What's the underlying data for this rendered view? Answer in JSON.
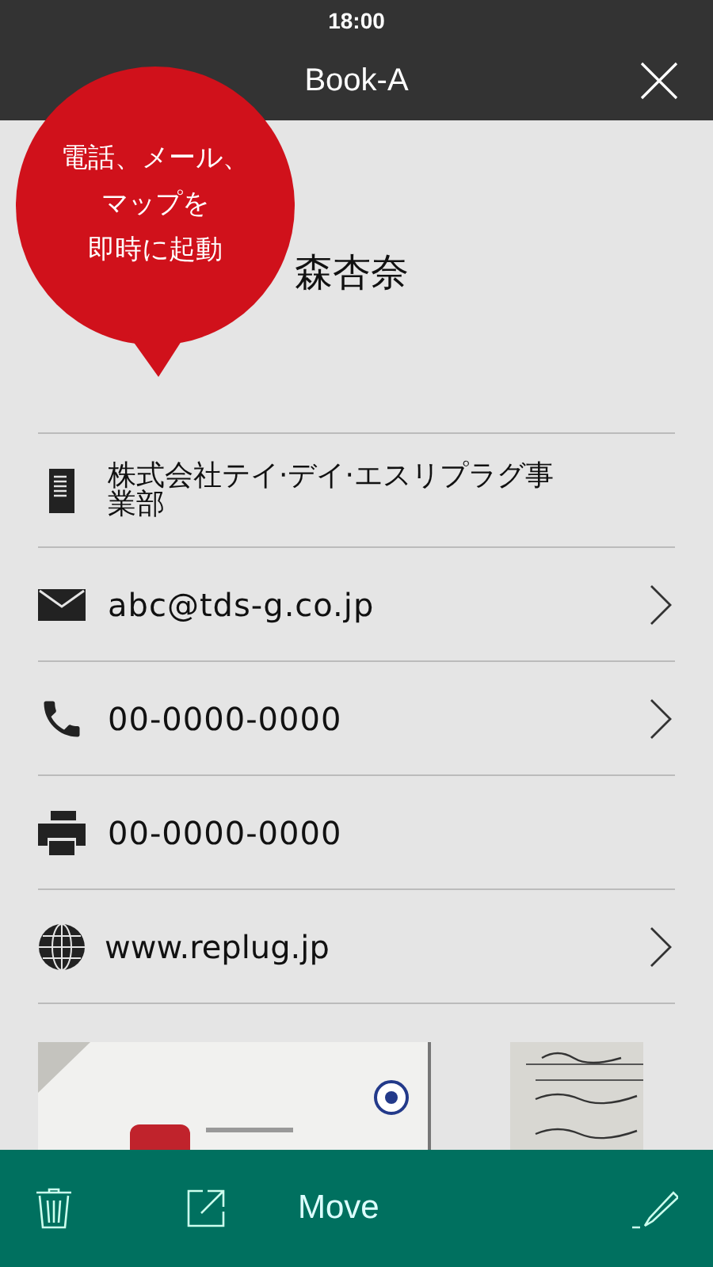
{
  "status_bar": {
    "time": "18:00"
  },
  "header": {
    "title": "Book-A"
  },
  "callout": {
    "lines": [
      "電話、メール、",
      "マップを",
      "即時に起動"
    ]
  },
  "contact": {
    "name": "森杏奈"
  },
  "rows": [
    {
      "kind": "company",
      "text": "株式会社テイ·デイ·エスリプラグ事業部",
      "has_arrow": false
    },
    {
      "kind": "email",
      "text": "abc@tds-g.co.jp",
      "has_arrow": true
    },
    {
      "kind": "phone",
      "text": "00-0000-0000",
      "has_arrow": true
    },
    {
      "kind": "fax",
      "text": "00-0000-0000",
      "has_arrow": false
    },
    {
      "kind": "web",
      "text": "www.replug.jp",
      "has_arrow": true
    }
  ],
  "toolbar": {
    "move_label": "Move"
  }
}
